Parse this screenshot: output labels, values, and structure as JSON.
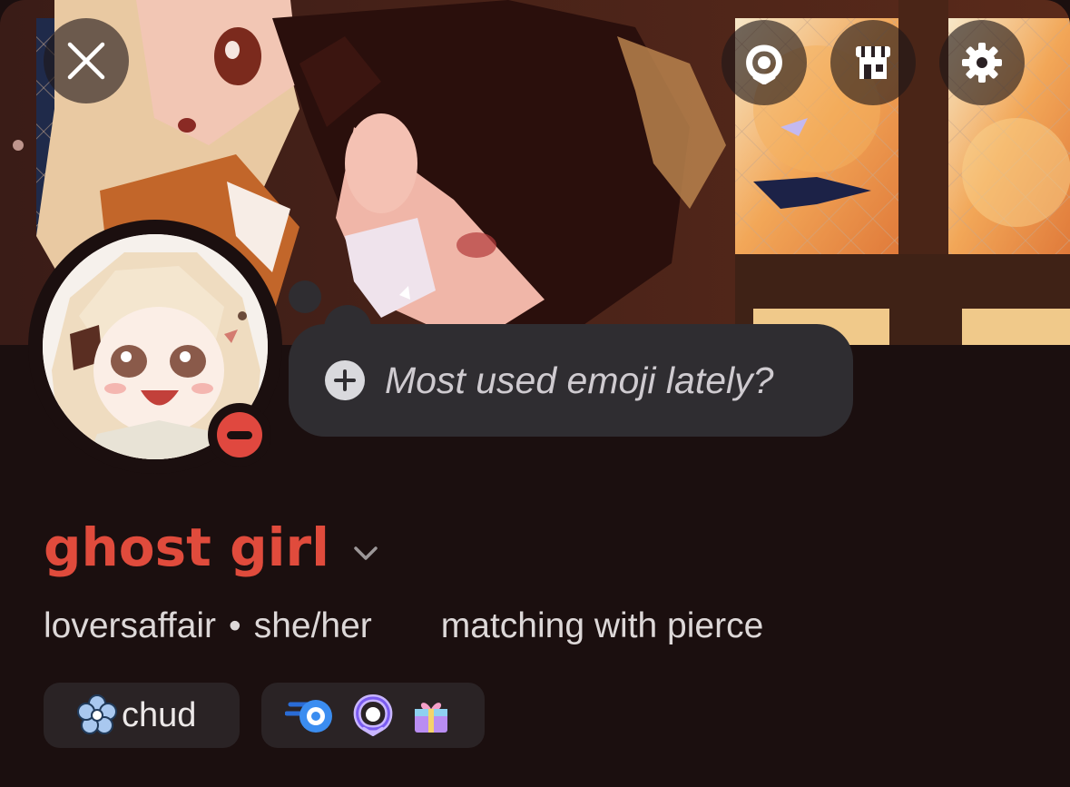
{
  "profile": {
    "display_name": "ghost girl",
    "username": "loversaffair",
    "separator": "•",
    "pronouns": "she/her",
    "bio": "matching with pierce",
    "status_placeholder": "Most used emoji lately?",
    "server_tag": "chud",
    "status": "do-not-disturb",
    "badges": [
      "nitro-boost-badge",
      "nitro-badge",
      "gift-badge"
    ]
  },
  "icons": {
    "close": "close-icon",
    "nitro": "nitro-wreath-icon",
    "shop": "shop-icon",
    "settings": "gear-icon",
    "add_status": "plus-icon",
    "expand": "chevron-down-icon",
    "tag": "flower-icon"
  },
  "colors": {
    "background": "#1b0f0f",
    "display_name": "#e04b3c",
    "bubble": "#2f2d31",
    "chip": "#2a2325",
    "status_dnd": "#e0483f"
  }
}
